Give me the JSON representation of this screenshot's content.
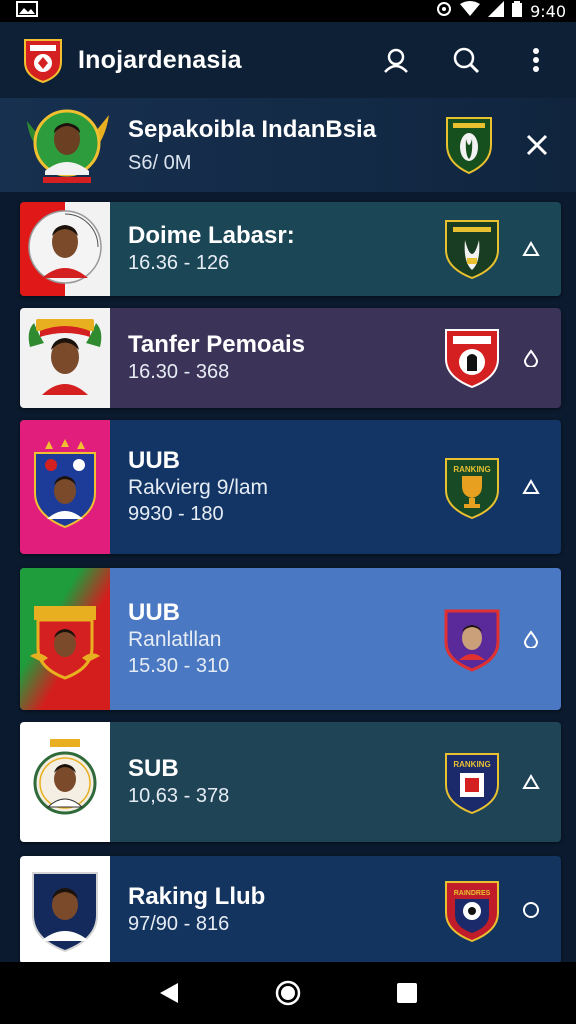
{
  "status_bar": {
    "time": "9:40",
    "icons": [
      "gallery-icon",
      "alarm-icon",
      "wifi-icon",
      "signal-icon",
      "battery-icon"
    ]
  },
  "app_bar": {
    "title": "Inojardenasia",
    "actions": [
      "profile-icon",
      "search-icon",
      "more-vert-icon"
    ]
  },
  "featured": {
    "title": "Sepakoibla  IndanBsia",
    "subtitle": "S6/ 0M",
    "close_icon": "close-icon"
  },
  "cards": [
    {
      "line1": "Doime Labasr:",
      "line2": "",
      "line3": "16.36 - 126",
      "bg": "#1b4656",
      "thumb_bg": "#d81c1c",
      "chevron": "triangle-up-icon"
    },
    {
      "line1": "Tanfer Pemoais",
      "line2": "",
      "line3": "16.30 - 368",
      "bg": "#3b3358",
      "thumb_bg": "#f2f2f2",
      "chevron": "drop-icon"
    },
    {
      "line1": "UUB",
      "line2": "Rakvierg 9/lam",
      "line3": "9930 - 180",
      "bg": "#123565",
      "thumb_bg": "#e21e7d",
      "chevron": "triangle-up-icon"
    },
    {
      "line1": "UUB",
      "line2": "Ranlatllan",
      "line3": "15.30 - 310",
      "bg": "#4a78c2",
      "thumb_bg": "#c41e1e",
      "chevron": "drop-icon"
    },
    {
      "line1": "SUB",
      "line2": "",
      "line3": "10,63 - 378",
      "bg": "#1f4456",
      "thumb_bg": "#ffffff",
      "chevron": "triangle-up-icon"
    },
    {
      "line1": "Raking Llub",
      "line2": "",
      "line3": "97/90 - 816",
      "bg": "#13345e",
      "thumb_bg": "#ffffff",
      "chevron": "circle-icon"
    }
  ],
  "crest_labels": {
    "card3": "RANKING",
    "card5": "RANKING",
    "card6": "RAINDRES"
  },
  "nav_bar": {
    "buttons": [
      "back-icon",
      "home-icon",
      "recents-icon"
    ]
  }
}
